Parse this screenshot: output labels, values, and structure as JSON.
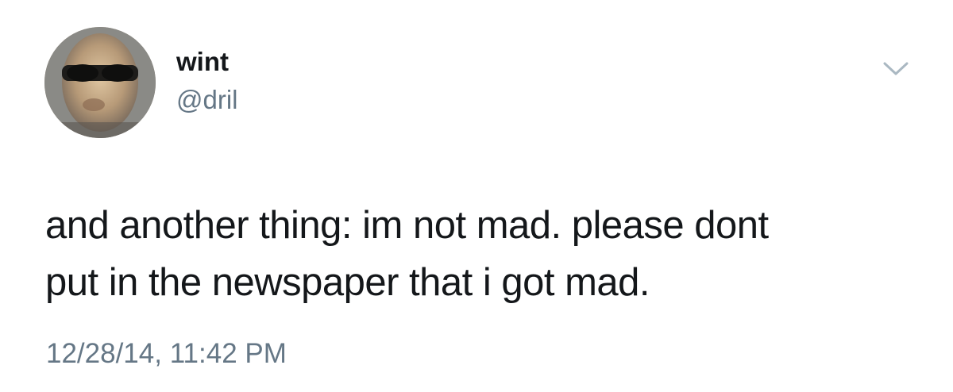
{
  "tweet": {
    "author": {
      "display_name": "wint",
      "handle": "@dril"
    },
    "text_line1": "and another thing: im not mad. please dont",
    "text_line2": "put in the newspaper that i got mad.",
    "timestamp": "12/28/14, 11:42 PM",
    "menu_icon": "chevron-down-icon",
    "colors": {
      "primary_text": "#14171a",
      "secondary_text": "#657786",
      "chevron": "#aab8c2"
    }
  }
}
